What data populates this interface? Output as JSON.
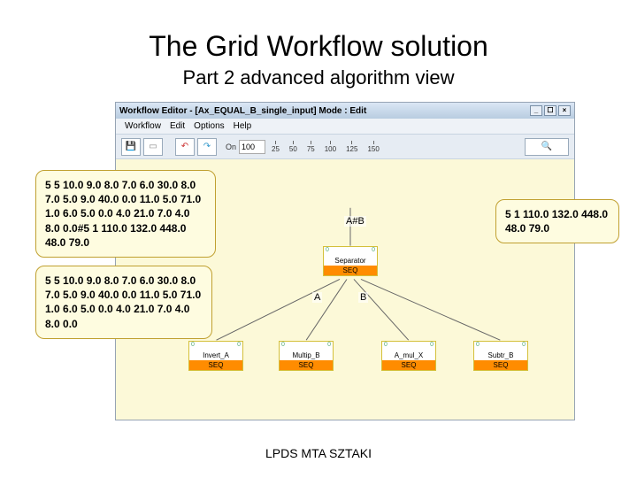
{
  "title": "The Grid Workflow solution",
  "subtitle": "Part 2 advanced algorithm view",
  "window": {
    "title": "Workflow Editor - [Ax_EQUAL_B_single_input]  Mode : Edit",
    "menus": {
      "workflow": "Workflow",
      "edit": "Edit",
      "options": "Options",
      "help": "Help"
    },
    "ruler": [
      "25",
      "50",
      "75",
      "100",
      "125",
      "150"
    ],
    "zoom": "100"
  },
  "nodes": {
    "separator": {
      "label": "Separator",
      "seq": "SEQ"
    },
    "invert_a": {
      "label": "Invert_A",
      "seq": "SEQ"
    },
    "multip_b": {
      "label": "Multip_B",
      "seq": "SEQ"
    },
    "a_mul_x": {
      "label": "A_mul_X",
      "seq": "SEQ"
    },
    "subtr_b": {
      "label": "Subtr_B",
      "seq": "SEQ"
    }
  },
  "edge_labels": {
    "ab_combo": "A#B",
    "a": "A",
    "b": "B"
  },
  "callouts": {
    "c1": "5 5 10.0 9.0 8.0 7.0 6.0 30.0 8.0 7.0 5.0 9.0 40.0 0.0 11.0 5.0 71.0 1.0 6.0 5.0 0.0 4.0 21.0 7.0 4.0 8.0 0.0#5 1 110.0 132.0 448.0 48.0 79.0",
    "c2": "5 5 10.0 9.0 8.0 7.0 6.0 30.0 8.0 7.0 5.0 9.0 40.0 0.0 11.0 5.0 71.0 1.0 6.0 5.0 0.0 4.0 21.0 7.0 4.0 8.0 0.0",
    "c3": "5 1 110.0 132.0 448.0 48.0 79.0"
  },
  "footer": "LPDS MTA SZTAKI"
}
